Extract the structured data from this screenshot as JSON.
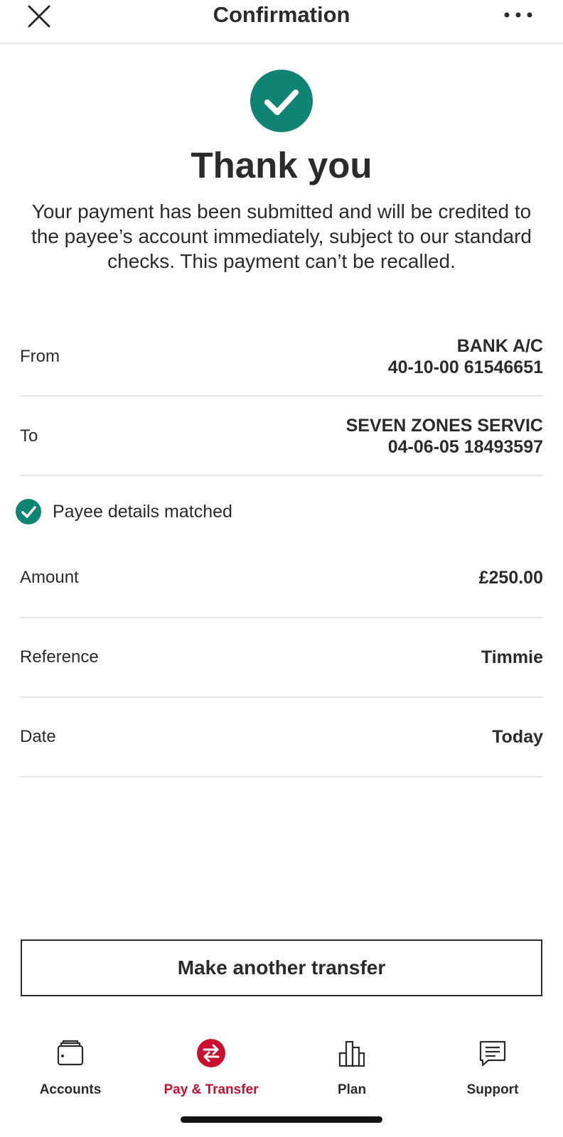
{
  "header": {
    "title": "Confirmation",
    "close_icon": "close-icon",
    "more_icon": "more-horizontal-icon"
  },
  "status": {
    "icon": "check-circle-icon",
    "title": "Thank you",
    "message": "Your payment has been submitted and will be credited to the payee’s account immediately, subject to our standard checks. This payment can’t be recalled."
  },
  "details": {
    "from": {
      "label": "From",
      "line1": "BANK A/C",
      "line2": "40-10-00 61546651"
    },
    "to": {
      "label": "To",
      "line1": "SEVEN ZONES SERVIC",
      "line2": "04-06-05 18493597"
    },
    "payee_match": {
      "icon": "check-circle-icon",
      "text": "Payee details matched"
    },
    "amount": {
      "label": "Amount",
      "value": "£250.00"
    },
    "reference": {
      "label": "Reference",
      "value": "Timmie"
    },
    "date": {
      "label": "Date",
      "value": "Today"
    }
  },
  "action": {
    "label": "Make another transfer"
  },
  "tabs": [
    {
      "label": "Accounts",
      "icon": "wallet-icon",
      "active": false
    },
    {
      "label": "Pay & Transfer",
      "icon": "transfer-icon",
      "active": true
    },
    {
      "label": "Plan",
      "icon": "bar-chart-icon",
      "active": false
    },
    {
      "label": "Support",
      "icon": "chat-icon",
      "active": false
    }
  ],
  "colors": {
    "success": "#0f8374",
    "accent": "#c8102e",
    "text": "#2b2b2b",
    "divider": "#e6e6e6"
  }
}
